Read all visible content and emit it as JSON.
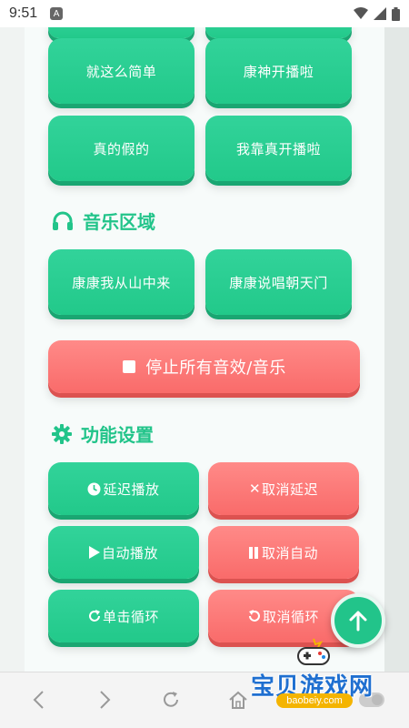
{
  "status": {
    "time": "9:51",
    "notif_letter": "A"
  },
  "buttons": {
    "top_left_partial": "",
    "top_right_partial": "",
    "row1_left": "就这么简单",
    "row1_right": "康神开播啦",
    "row2_left": "真的假的",
    "row2_right": "我靠真开播啦"
  },
  "music": {
    "title": "音乐区域",
    "left": "康康我从山中来",
    "right": "康康说唱朝天门"
  },
  "stop_button": "停止所有音效/音乐",
  "features": {
    "title": "功能设置",
    "delay_play": "延迟播放",
    "cancel_delay": "取消延迟",
    "auto_play": "自动播放",
    "cancel_auto": "取消自动",
    "loop_single": "单击循环",
    "cancel_loop": "取消循环"
  },
  "watermark": {
    "site": "宝贝游戏网",
    "url": "baobeiy.com"
  },
  "colors": {
    "green": "#22c98a",
    "red": "#f96b6a",
    "accent": "#22c48a"
  }
}
